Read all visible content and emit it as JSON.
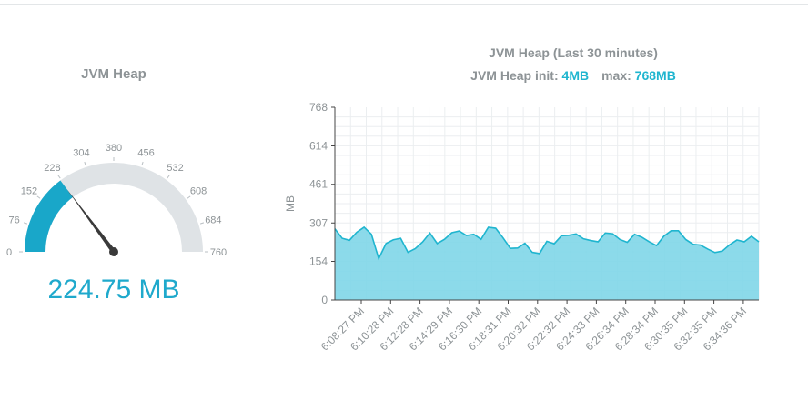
{
  "gauge": {
    "title": "JVM Heap",
    "value_text": "224.75 MB",
    "value": 224.75,
    "min": 0,
    "max": 760,
    "tick_labels": [
      "0",
      "76",
      "152",
      "228",
      "304",
      "380",
      "456",
      "532",
      "608",
      "684",
      "760"
    ],
    "fill_color": "#19a7c9",
    "track_color": "#dfe3e6",
    "needle_color": "#3a3a3a"
  },
  "chart": {
    "title": "JVM Heap (Last 30 minutes)",
    "init_label": "JVM Heap init:",
    "init_value": "4MB",
    "max_label": "max:",
    "max_value": "768MB",
    "accent_color": "#1fb5cf"
  },
  "chart_data": {
    "type": "area",
    "title": "JVM Heap (Last 30 minutes)",
    "xlabel": "",
    "ylabel": "MB",
    "ylim": [
      0,
      768
    ],
    "yticks": [
      0,
      154,
      307,
      461,
      614,
      768
    ],
    "x_tick_labels": [
      "6:08:27 PM",
      "6:10:28 PM",
      "6:12:28 PM",
      "6:14:29 PM",
      "6:16:30 PM",
      "6:18:31 PM",
      "6:20:32 PM",
      "6:22:32 PM",
      "6:24:33 PM",
      "6:26:34 PM",
      "6:28:34 PM",
      "6:30:35 PM",
      "6:32:35 PM",
      "6:34:36 PM"
    ],
    "grid": true,
    "legend": "none",
    "series": [
      {
        "color": "#1fb5cf",
        "fill": "#7fd6e8",
        "values": [
          284,
          246,
          238,
          270,
          290,
          262,
          165,
          225,
          240,
          246,
          190,
          205,
          231,
          267,
          225,
          242,
          268,
          275,
          257,
          262,
          242,
          290,
          286,
          248,
          206,
          207,
          226,
          190,
          185,
          234,
          224,
          256,
          258,
          263,
          244,
          237,
          232,
          267,
          264,
          241,
          230,
          262,
          250,
          232,
          217,
          254,
          276,
          276,
          241,
          222,
          219,
          203,
          189,
          195,
          220,
          239,
          232,
          254,
          232
        ]
      }
    ]
  }
}
